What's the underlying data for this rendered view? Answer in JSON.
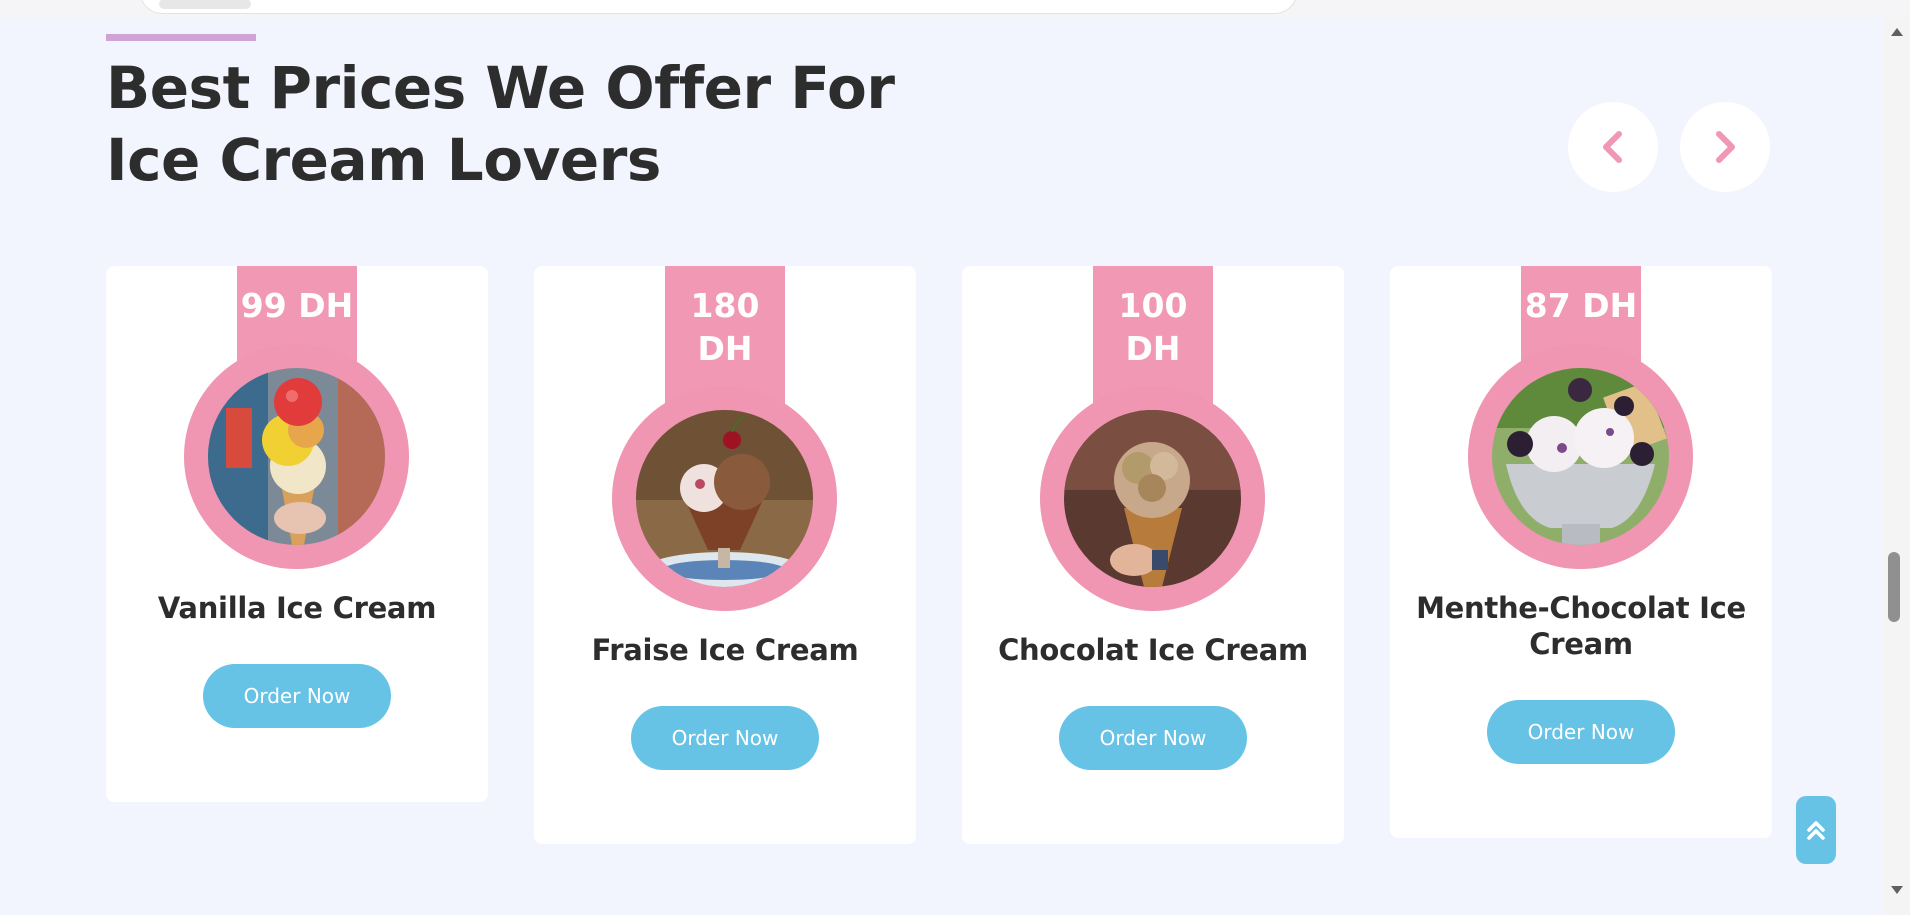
{
  "section": {
    "title_line1": "Best Prices We Offer For",
    "title_line2": "Ice Cream Lovers"
  },
  "carousel": {
    "prev_icon": "chevron-left-icon",
    "next_icon": "chevron-right-icon"
  },
  "products": [
    {
      "price": "99 DH",
      "name": "Vanilla Ice Cream",
      "button": "Order Now",
      "image": "vanilla-ice-cream-cone"
    },
    {
      "price": "180 DH",
      "price_line1": "180",
      "price_line2": "DH",
      "name": "Fraise Ice Cream",
      "button": "Order Now",
      "image": "fraise-ice-cream-sundae"
    },
    {
      "price": "100 DH",
      "price_line1": "100",
      "price_line2": "DH",
      "name": "Chocolat Ice Cream",
      "button": "Order Now",
      "image": "chocolat-ice-cream-cone"
    },
    {
      "price": "87 DH",
      "name": "Menthe-Chocolat Ice Cream",
      "name_line1": "Menthe-Chocolat Ice",
      "name_line2": "Cream",
      "button": "Order Now",
      "image": "menthe-chocolat-ice-cream-bowl"
    }
  ],
  "scroll_top": {
    "icon": "double-chevron-up-icon"
  },
  "colors": {
    "background": "#f2f5fe",
    "accent_pink": "#f198b4",
    "button_blue": "#66c3e6",
    "title_text": "#2d2d2d",
    "accent_line": "#cfa3d3"
  }
}
